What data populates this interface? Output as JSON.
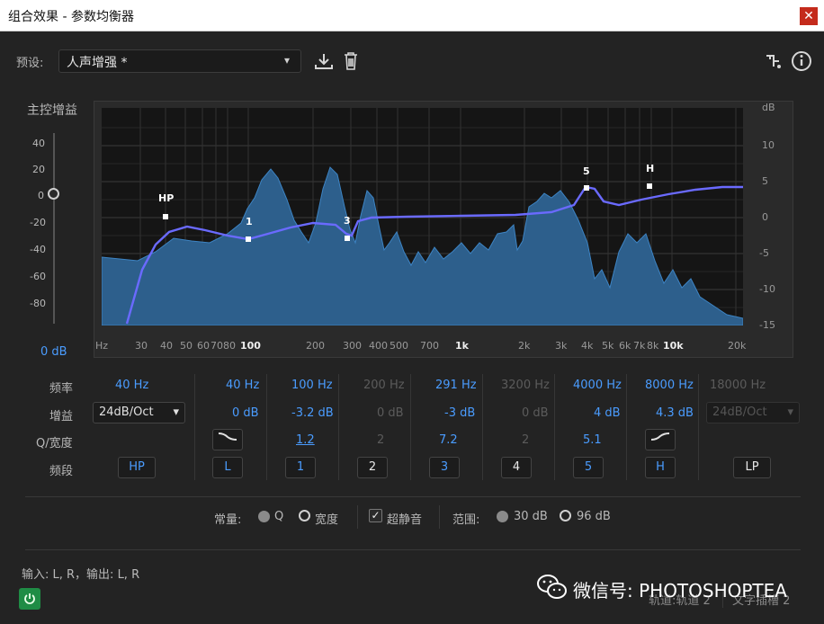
{
  "window": {
    "title": "组合效果 - 参数均衡器",
    "close_label": "✕"
  },
  "preset": {
    "label": "预设:",
    "value": "人声增强 *"
  },
  "master": {
    "label": "主控增益",
    "ticks": [
      "40",
      "20",
      "0",
      "-20",
      "-40",
      "-60",
      "-80"
    ],
    "value": "0 dB"
  },
  "graph": {
    "db_axis": [
      "dB",
      "10",
      "5",
      "0",
      "-5",
      "-10",
      "-15"
    ],
    "freq_axis": [
      "Hz",
      "30",
      "40",
      "50",
      "60",
      "70",
      "80",
      "100",
      "200",
      "300",
      "400",
      "500",
      "700",
      "1k",
      "2k",
      "3k",
      "4k",
      "5k",
      "6k",
      "7k",
      "8k",
      "10k",
      "20k"
    ],
    "node_labels": [
      "HP",
      "1",
      "3",
      "5",
      "H"
    ]
  },
  "rows": {
    "freq_label": "频率",
    "gain_label": "增益",
    "q_label": "Q/宽度",
    "band_label": "频段"
  },
  "bands": [
    {
      "freq": "40 Hz",
      "gain": "24dB/Oct",
      "q": "",
      "btn": "HP",
      "active": true,
      "type": "select"
    },
    {
      "freq": "40 Hz",
      "gain": "0 dB",
      "q": "",
      "btn": "L",
      "active": true,
      "type": "shelf-low"
    },
    {
      "freq": "100 Hz",
      "gain": "-3.2 dB",
      "q": "1.2",
      "btn": "1",
      "active": true,
      "type": "peak"
    },
    {
      "freq": "200 Hz",
      "gain": "0 dB",
      "q": "2",
      "btn": "2",
      "active": false,
      "type": "peak"
    },
    {
      "freq": "291 Hz",
      "gain": "-3 dB",
      "q": "7.2",
      "btn": "3",
      "active": true,
      "type": "peak"
    },
    {
      "freq": "3200 Hz",
      "gain": "0 dB",
      "q": "2",
      "btn": "4",
      "active": false,
      "type": "peak"
    },
    {
      "freq": "4000 Hz",
      "gain": "4 dB",
      "q": "5.1",
      "btn": "5",
      "active": true,
      "type": "peak"
    },
    {
      "freq": "8000 Hz",
      "gain": "4.3 dB",
      "q": "",
      "btn": "H",
      "active": true,
      "type": "shelf-high"
    },
    {
      "freq": "18000 Hz",
      "gain": "24dB/Oct",
      "q": "",
      "btn": "LP",
      "active": false,
      "type": "select"
    }
  ],
  "options": {
    "constant_label": "常量:",
    "q_label": "Q",
    "width_label": "宽度",
    "ultra_quiet_label": "超静音",
    "range_label": "范围:",
    "range_30": "30 dB",
    "range_96": "96 dB"
  },
  "footer": {
    "io": "输入: L, R，输出: L, R",
    "track": "轨道:轨道 2",
    "insert": "文字插槽 2"
  },
  "watermark": {
    "text": "微信号: PHOTOSHOPTEA"
  },
  "colors": {
    "accent": "#4a9cff",
    "curve": "#6a6aff",
    "spectrum": "#3d74a6",
    "power": "#1f8c45"
  }
}
